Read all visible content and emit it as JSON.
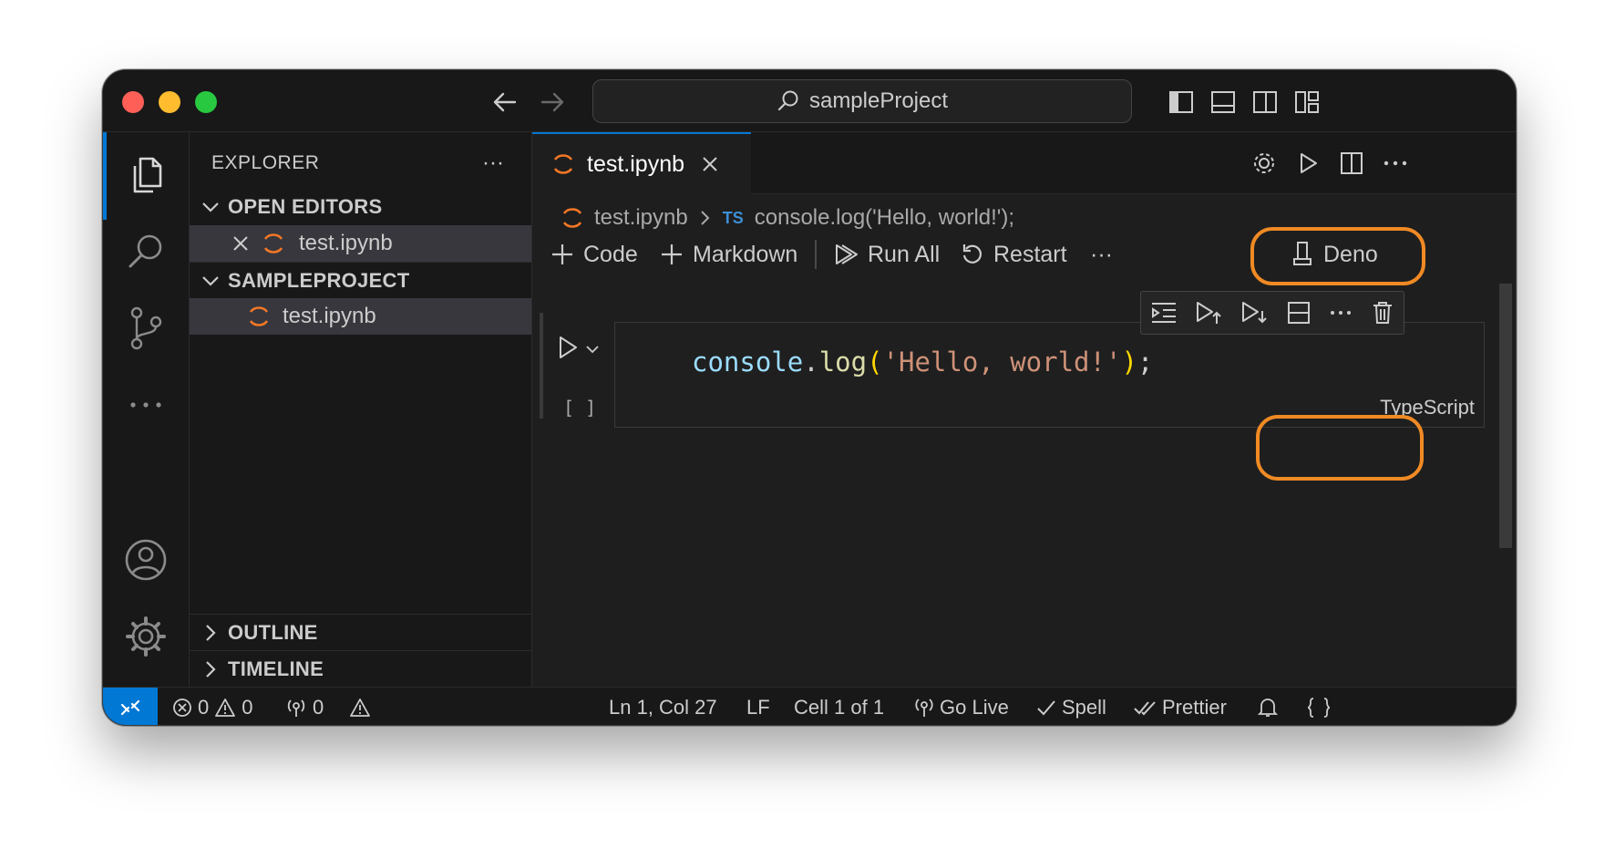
{
  "titlebar": {
    "search_text": "sampleProject"
  },
  "sidebar": {
    "title": "EXPLORER",
    "more_label": "···",
    "open_editors": {
      "label": "OPEN EDITORS",
      "items": [
        {
          "name": "test.ipynb"
        }
      ]
    },
    "project": {
      "label": "SAMPLEPROJECT",
      "items": [
        {
          "name": "test.ipynb"
        }
      ]
    },
    "outline_label": "OUTLINE",
    "timeline_label": "TIMELINE"
  },
  "editor": {
    "tab": {
      "label": "test.ipynb"
    },
    "breadcrumb": {
      "file": "test.ipynb",
      "lang_badge": "TS",
      "symbol": "console.log('Hello, world!');"
    },
    "toolbar": {
      "code": "Code",
      "markdown": "Markdown",
      "run_all": "Run All",
      "restart": "Restart",
      "more": "···",
      "kernel": "Deno"
    },
    "cell": {
      "code_obj": "console",
      "code_dot": ".",
      "code_fn": "log",
      "code_open": "(",
      "code_str": "'Hello, world!'",
      "code_close": ")",
      "code_semi": ";",
      "exec_count": "[ ]",
      "language": "TypeScript"
    }
  },
  "statusbar": {
    "errors": "0",
    "warnings": "0",
    "ports": "0",
    "position": "Ln 1, Col 27",
    "eol": "LF",
    "cell": "Cell 1 of 1",
    "go_live": "Go Live",
    "spell": "Spell",
    "prettier": "Prettier"
  },
  "colors": {
    "accent": "#0078d4",
    "highlight": "#f08a24",
    "jupyter_orange": "#f37726"
  }
}
